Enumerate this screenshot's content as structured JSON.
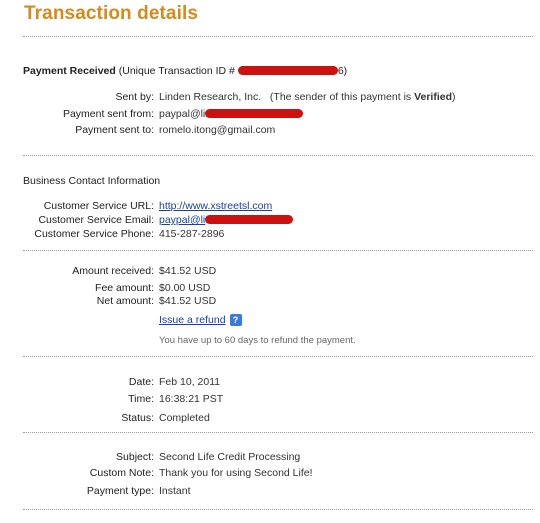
{
  "title": "Transaction details",
  "payment_received": {
    "heading": "Payment Received",
    "id_label": "(Unique Transaction ID #",
    "id_end": "6)"
  },
  "sender": {
    "sent_by_label": "Sent by:",
    "sent_by_value": "Linden Research, Inc.",
    "sender_note_prefix": "(The sender of this payment is",
    "sender_note_status": "Verified",
    "sender_note_suffix": ")",
    "sent_from_label": "Payment sent from:",
    "sent_from_value": "paypal@li",
    "sent_to_label": "Payment sent to:",
    "sent_to_value": "romelo.itong@gmail.com"
  },
  "business": {
    "heading": "Business Contact Information",
    "url_label": "Customer Service URL:",
    "url_value": "http://www.xstreetsl.com",
    "email_label": "Customer Service Email:",
    "email_value": "paypal@li",
    "phone_label": "Customer Service Phone:",
    "phone_value": "415-287-2896"
  },
  "amounts": {
    "received_label": "Amount received:",
    "received_value": "$41.52 USD",
    "fee_label": "Fee amount:",
    "fee_value": "$0.00 USD",
    "net_label": "Net amount:",
    "net_value": "$41.52 USD",
    "refund_link": "Issue a refund",
    "help_icon": "?",
    "refund_note": "You have up to 60 days to refund the payment."
  },
  "timing": {
    "date_label": "Date:",
    "date_value": "Feb 10, 2011",
    "time_label": "Time:",
    "time_value": "16:38:21 PST",
    "status_label": "Status:",
    "status_value": "Completed"
  },
  "details": {
    "subject_label": "Subject:",
    "subject_value": "Second Life Credit Processing",
    "note_label": "Custom Note:",
    "note_value": "Thank you for using Second Life!",
    "type_label": "Payment type:",
    "type_value": "Instant"
  },
  "colors": {
    "title": "#d48a1c",
    "redaction": "#cc1111",
    "link": "#1a3fa6"
  }
}
